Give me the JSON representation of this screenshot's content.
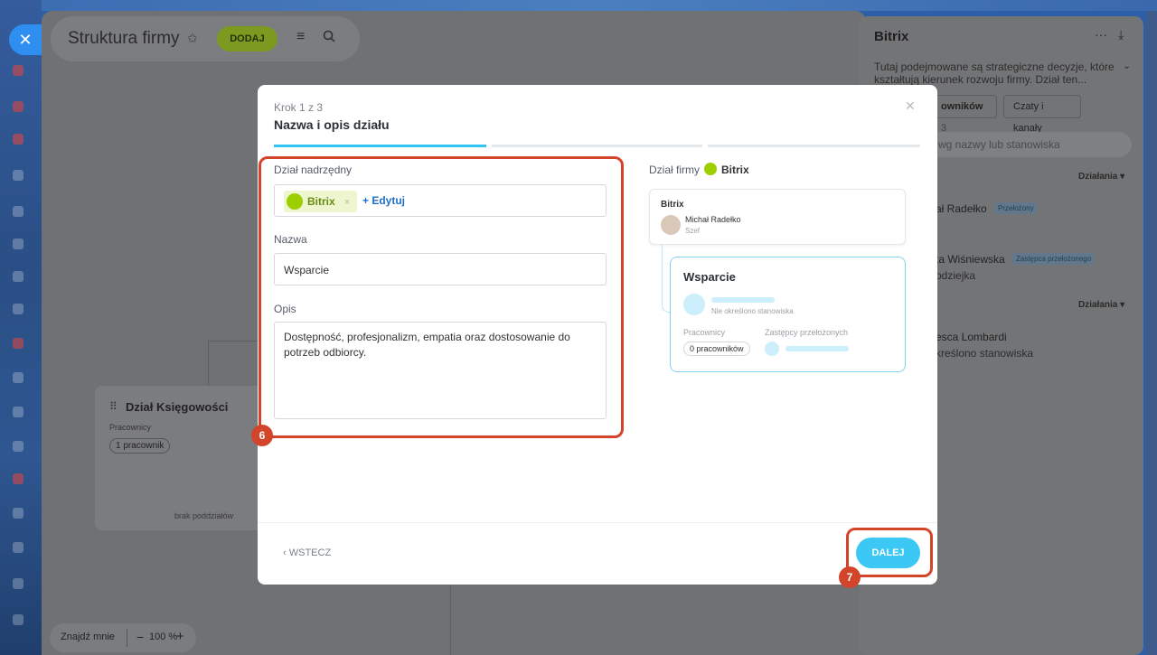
{
  "app": {
    "page_title": "Struktura firmy",
    "add_button": "DODAJ"
  },
  "background_card": {
    "title": "Dział Księgowości",
    "employees_label": "Pracownicy",
    "employees_chip": "1 pracownik",
    "no_subdepartments": "brak poddziałów"
  },
  "zoom": {
    "find_me": "Znajdź mnie",
    "minus": "−",
    "value": "100 %",
    "plus": "+"
  },
  "right_panel": {
    "title": "Bitrix",
    "description": "Tutaj podejmowane są strategiczne decyzje, które kształtują kierunek rozwoju firmy. Dział ten...",
    "tab_employees_label": "owników",
    "tab_employees_count": "3",
    "tab_chats": "Czaty i kanały",
    "search_placeholder": "wg nazwy lub stanowiska",
    "actions_label_1": "Działania",
    "actions_label_2": "Działania",
    "people": [
      {
        "name": "ał Radełko",
        "badge": "Przełożony",
        "subtitle": ""
      },
      {
        "name": "ta Wiśniewska",
        "badge": "Zastępca przełożonego",
        "subtitle": "odziejka"
      },
      {
        "name": "esca Lombardi",
        "badge": "",
        "subtitle": "kreślono stanowiska"
      }
    ]
  },
  "modal": {
    "step": "Krok 1 z 3",
    "title": "Nazwa i opis działu",
    "parent_label": "Dział nadrzędny",
    "parent_tag": "Bitrix",
    "parent_tag_remove": "×",
    "edit_link": "+ Edytuj",
    "name_label": "Nazwa",
    "name_value": "Wsparcie",
    "description_label": "Opis",
    "description_value": "Dostępność, profesjonalizm, empatia oraz dostosowanie do potrzeb odbiorcy.",
    "back_button": "‹  WSTECZ",
    "next_button": "DALEJ",
    "annotation_6": "6",
    "annotation_7": "7"
  },
  "preview": {
    "label": "Dział firmy",
    "company": "Bitrix",
    "parent_card_title": "Bitrix",
    "manager_name": "Michał Radełko",
    "manager_role": "Szef",
    "new_card_title": "Wsparcie",
    "no_position": "Nie określono stanowiska",
    "employees_label": "Pracownicy",
    "deputies_label": "Zastępcy przełożonych",
    "employees_chip": "0 pracowników"
  },
  "colors": {
    "accent_blue": "#3bc8f5",
    "annotation_red": "#d2452a",
    "tag_green": "#9dcf00"
  }
}
